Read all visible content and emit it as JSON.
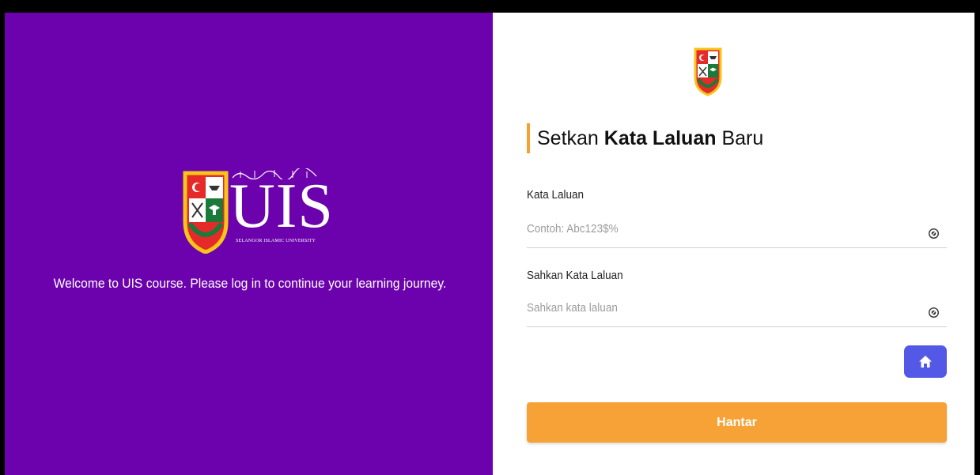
{
  "left": {
    "logo_text": "UIS",
    "logo_subtext": "SELANGOR ISLAMIC UNIVERSITY",
    "welcome": "Welcome to UIS course. Please log in to continue your learning journey."
  },
  "form": {
    "heading_prefix": "Setkan",
    "heading_bold": "Kata Laluan",
    "heading_suffix": "Baru",
    "password_label": "Kata Laluan",
    "password_placeholder": "Contoh: Abc123$%",
    "password_value": "",
    "confirm_label": "Sahkan Kata Laluan",
    "confirm_placeholder": "Sahkan kata laluan",
    "confirm_value": "",
    "submit_label": "Hantar"
  },
  "icons": {
    "password_toggle": "eye-icon",
    "confirm_toggle": "eye-icon",
    "home": "home-icon"
  },
  "colors": {
    "left_panel": "#6c02ad",
    "accent": "#f7a236",
    "home_button": "#5458e6"
  }
}
